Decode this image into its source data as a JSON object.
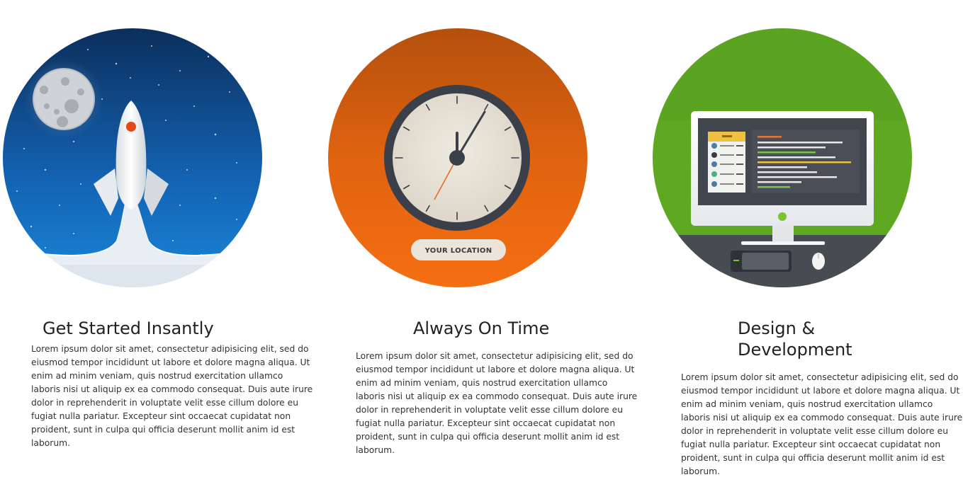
{
  "features": [
    {
      "title": "Get Started Insantly",
      "illustration": "rocket-launch-icon",
      "body": "Lorem ipsum dolor sit amet, consectetur adipisicing elit, sed do eiusmod tempor incididunt ut labore et dolore magna aliqua. Ut enim ad minim veniam, quis nostrud exercitation ullamco laboris nisi ut aliquip ex ea commodo consequat. Duis aute irure dolor in reprehenderit in voluptate velit esse cillum dolore eu fugiat nulla pariatur. Excepteur sint occaecat cupidatat non proident, sunt in culpa qui officia deserunt mollit anim id est laborum."
    },
    {
      "title": "Always On Time",
      "illustration": "clock-icon",
      "badge": "YOUR LOCATION",
      "body": "Lorem ipsum dolor sit amet, consectetur adipisicing elit, sed do eiusmod tempor incididunt ut labore et dolore magna aliqua. Ut enim ad minim veniam, quis nostrud exercitation ullamco laboris nisi ut aliquip ex ea commodo consequat. Duis aute irure dolor in reprehenderit in voluptate velit esse cillum dolore eu fugiat nulla pariatur. Excepteur sint occaecat cupidatat non proident, sunt in culpa qui officia deserunt mollit anim id est laborum."
    },
    {
      "title": "Design & Development",
      "illustration": "desktop-computer-icon",
      "body": "Lorem ipsum dolor sit amet, consectetur adipisicing elit, sed do eiusmod tempor incididunt ut labore et dolore magna aliqua. Ut enim ad minim veniam, quis nostrud exercitation ullamco laboris nisi ut aliquip ex ea commodo consequat. Duis aute irure dolor in reprehenderit in voluptate velit esse cillum dolore eu fugiat nulla pariatur. Excepteur sint occaecat cupidatat non proident, sunt in culpa qui officia deserunt mollit anim id est laborum."
    }
  ],
  "colors": {
    "space_dark": "#0b3566",
    "space_light": "#1a7fd1",
    "orange_dark": "#b8520f",
    "orange_light": "#f36b12",
    "green": "#5aa620",
    "desk_dark": "#474b52",
    "title_text": "#222222",
    "body_text": "#333333"
  }
}
